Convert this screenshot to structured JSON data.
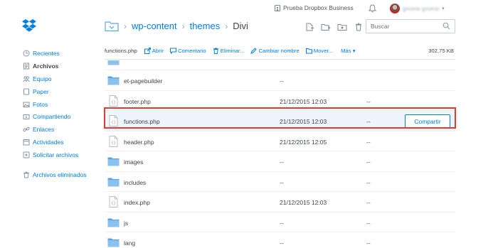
{
  "colors": {
    "accent": "#007ee5",
    "folder": "#5aa5e6",
    "highlight": "#e03b2c",
    "selected_row": "#edf4fc"
  },
  "header": {
    "business_label": "Prueba Dropbox Business",
    "user_name": "gnome gnome"
  },
  "sidebar": {
    "items": [
      {
        "label": "Recientes",
        "icon": "clock-icon"
      },
      {
        "label": "Archivos",
        "icon": "files-icon"
      },
      {
        "label": "Equipo",
        "icon": "team-icon"
      },
      {
        "label": "Paper",
        "icon": "paper-icon"
      },
      {
        "label": "Fotos",
        "icon": "photos-icon"
      },
      {
        "label": "Compartiendo",
        "icon": "sharing-icon"
      },
      {
        "label": "Enlaces",
        "icon": "links-icon"
      },
      {
        "label": "Actividades",
        "icon": "activity-icon"
      },
      {
        "label": "Solicitar archivos",
        "icon": "file-request-icon"
      }
    ],
    "deleted_label": "Archivos eliminados"
  },
  "breadcrumb": {
    "items": [
      "wp-content",
      "themes",
      "Divi"
    ]
  },
  "search": {
    "placeholder": "Buscar"
  },
  "actions": {
    "file_name": "functions.php",
    "open": "Abrir",
    "comment": "Comentario",
    "delete": "Eliminar...",
    "rename": "Cambiar nombre",
    "move": "Mover...",
    "more": "Más ▾",
    "size": "302,75 KB"
  },
  "files": [
    {
      "name": "et-pagebuilder",
      "type": "folder",
      "date": "--",
      "size": ""
    },
    {
      "name": "footer.php",
      "type": "file",
      "date": "21/12/2015 12:03",
      "size": "--"
    },
    {
      "name": "functions.php",
      "type": "file",
      "date": "21/12/2015 12:03",
      "size": "--",
      "selected": true
    },
    {
      "name": "header.php",
      "type": "file",
      "date": "21/12/2015 12:05",
      "size": "--"
    },
    {
      "name": "images",
      "type": "folder",
      "date": "--",
      "size": "--"
    },
    {
      "name": "includes",
      "type": "folder",
      "date": "--",
      "size": "--"
    },
    {
      "name": "index.php",
      "type": "file",
      "date": "21/12/2015 12:03",
      "size": "--"
    },
    {
      "name": "js",
      "type": "folder",
      "date": "--",
      "size": "--"
    },
    {
      "name": "lang",
      "type": "folder",
      "date": "--",
      "size": "--"
    }
  ],
  "share_label": "Compartir"
}
